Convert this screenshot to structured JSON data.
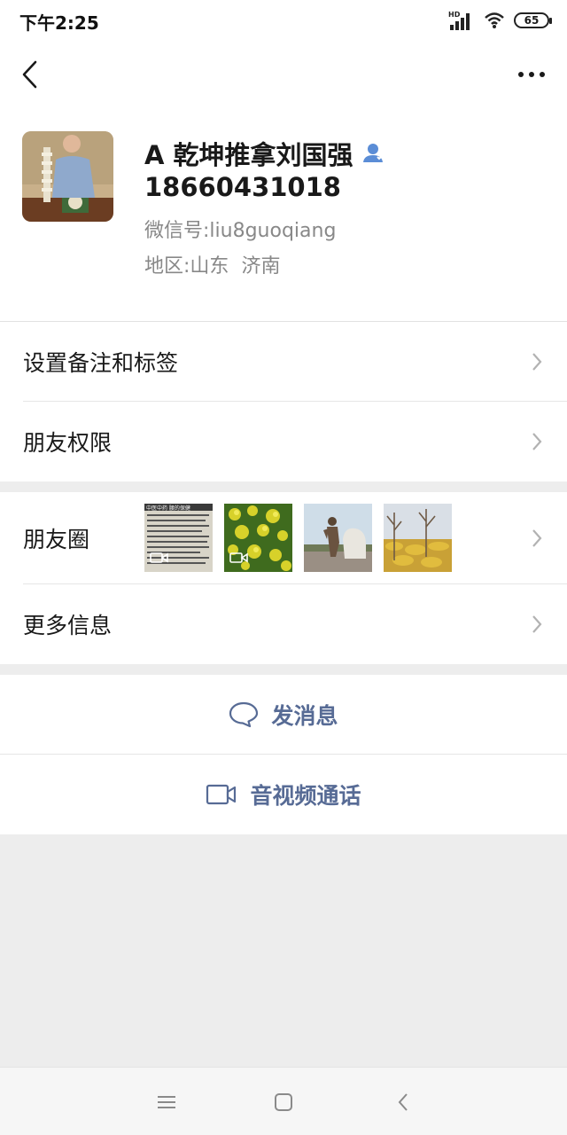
{
  "status": {
    "time": "下午2:25",
    "network": "HD",
    "battery": "65"
  },
  "profile": {
    "name": "A 乾坤推拿刘国强",
    "phone": "18660431018",
    "wechat_id_label": "微信号:",
    "wechat_id": "liu8guoqiang",
    "region_label": "地区:",
    "province": "山东",
    "city": "济南"
  },
  "menu": {
    "remark_tags": "设置备注和标签",
    "friend_permissions": "朋友权限",
    "moments": "朋友圈",
    "more_info": "更多信息"
  },
  "actions": {
    "send_message": "发消息",
    "av_call": "音视频通话"
  },
  "moments_thumbnails": [
    {
      "kind": "video",
      "caption": "中医中药 腰的保健"
    },
    {
      "kind": "video"
    },
    {
      "kind": "image"
    },
    {
      "kind": "image"
    }
  ],
  "colors": {
    "link_blue": "#576b95",
    "verified_blue": "#5b8dd6",
    "page_bg": "#ededed"
  }
}
